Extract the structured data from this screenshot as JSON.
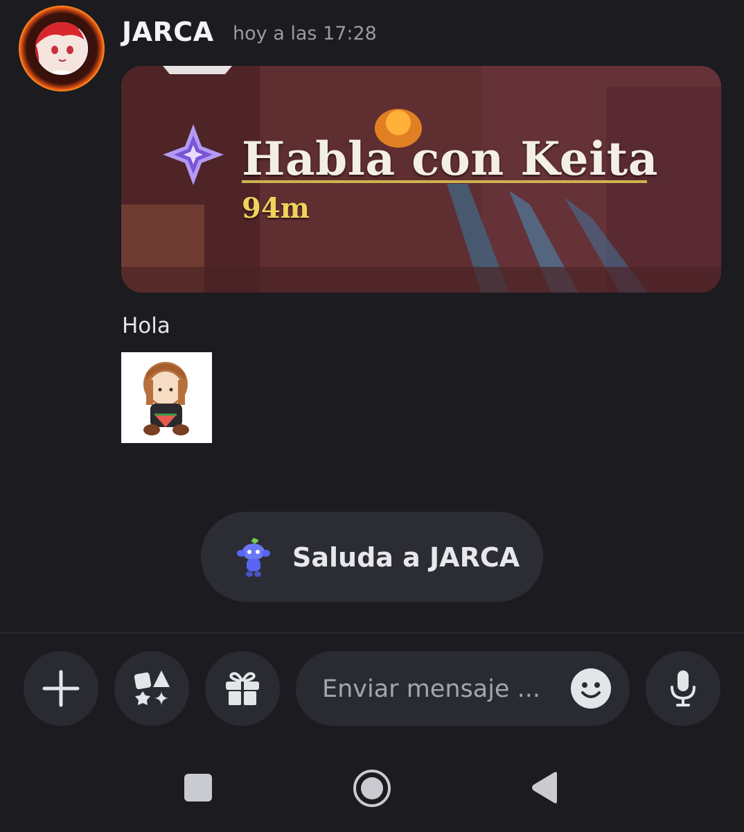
{
  "message": {
    "username": "JARCA",
    "timestamp": "hoy a las 17:28",
    "attachment": {
      "quest_title": "Habla con Keita",
      "quest_distance": "94m"
    },
    "text": "Hola",
    "sticker_icon": "plush-doll-sticker"
  },
  "wave_button": {
    "label": "Saluda a JARCA",
    "icon": "wumpus-icon"
  },
  "input_bar": {
    "buttons": [
      {
        "name": "add-attachment-button",
        "icon": "plus-icon"
      },
      {
        "name": "apps-button",
        "icon": "apps-shapes-icon"
      },
      {
        "name": "gift-button",
        "icon": "gift-icon"
      }
    ],
    "placeholder": "Enviar mensaje ...",
    "emoji_icon": "smile-icon",
    "voice_icon": "microphone-icon"
  },
  "nav_bar": {
    "buttons": [
      "recents-square-icon",
      "home-circle-icon",
      "back-triangle-icon"
    ]
  },
  "colors": {
    "background": "#1b1b20",
    "surface": "#2a2b32",
    "wave_accent": "#5865f2",
    "quest_gold": "#f0d35b"
  }
}
